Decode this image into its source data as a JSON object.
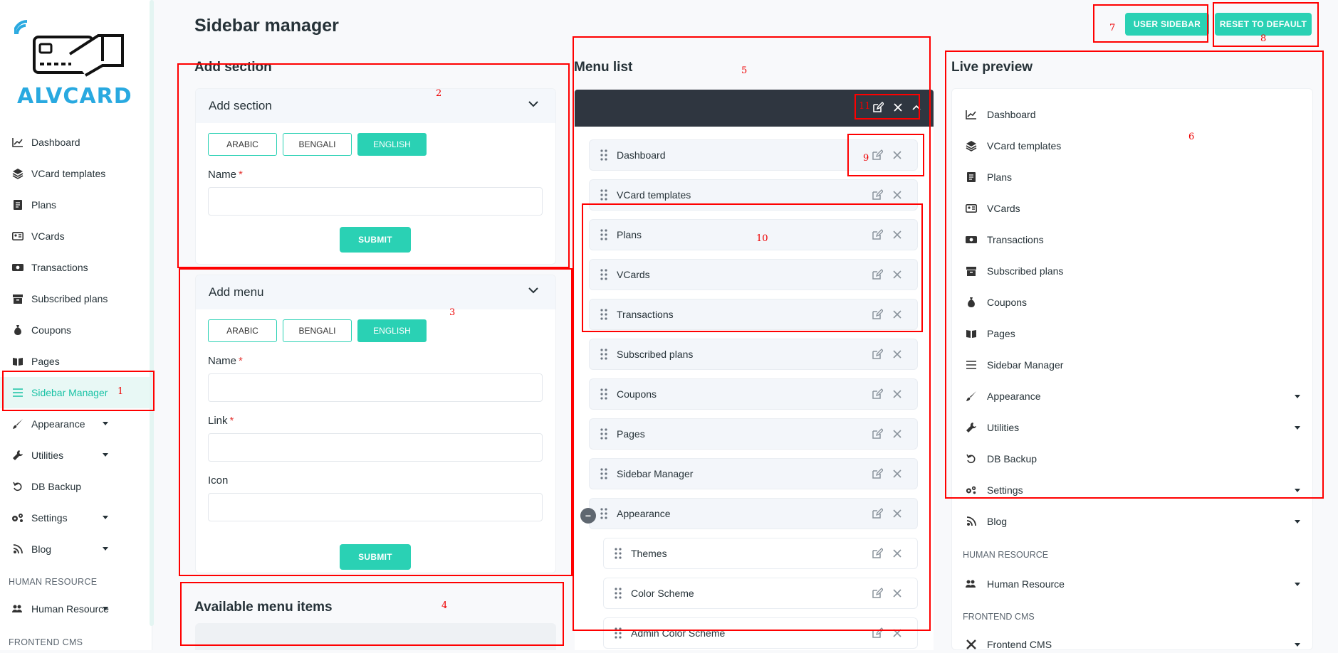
{
  "brand": {
    "logo_text": "ALVCARD"
  },
  "sidebar": {
    "items": [
      {
        "label": "Dashboard",
        "icon": "chart-line-icon",
        "dropdown": false,
        "active": false
      },
      {
        "label": "VCard templates",
        "icon": "layers-icon",
        "dropdown": false,
        "active": false
      },
      {
        "label": "Plans",
        "icon": "document-icon",
        "dropdown": false,
        "active": false
      },
      {
        "label": "VCards",
        "icon": "id-card-icon",
        "dropdown": false,
        "active": false
      },
      {
        "label": "Transactions",
        "icon": "money-bill-icon",
        "dropdown": false,
        "active": false
      },
      {
        "label": "Subscribed plans",
        "icon": "archive-box-icon",
        "dropdown": false,
        "active": false
      },
      {
        "label": "Coupons",
        "icon": "money-bag-icon",
        "dropdown": false,
        "active": false
      },
      {
        "label": "Pages",
        "icon": "open-book-icon",
        "dropdown": false,
        "active": false
      },
      {
        "label": "Sidebar Manager",
        "icon": "bars-icon",
        "dropdown": false,
        "active": true
      },
      {
        "label": "Appearance",
        "icon": "paint-brush-icon",
        "dropdown": true,
        "active": false
      },
      {
        "label": "Utilities",
        "icon": "wrench-icon",
        "dropdown": true,
        "active": false
      },
      {
        "label": "DB Backup",
        "icon": "undo-icon",
        "dropdown": false,
        "active": false
      },
      {
        "label": "Settings",
        "icon": "gears-icon",
        "dropdown": true,
        "active": false
      },
      {
        "label": "Blog",
        "icon": "blog-icon",
        "dropdown": true,
        "active": false
      }
    ],
    "heading_hr": "HUMAN RESOURCE",
    "item_hr": {
      "label": "Human Resource",
      "icon": "users-cog-icon"
    },
    "heading_cms": "FRONTEND CMS"
  },
  "page": {
    "title": "Sidebar manager"
  },
  "toolbar": {
    "user_sidebar": "USER SIDEBAR",
    "reset_default": "RESET TO DEFAULT"
  },
  "add_section": {
    "column_title": "Add section",
    "card_title": "Add section",
    "languages": [
      "ARABIC",
      "BENGALI",
      "ENGLISH"
    ],
    "selected_language": "ENGLISH",
    "name_label": "Name",
    "required_mark": "*",
    "name_value": "",
    "submit": "SUBMIT"
  },
  "add_menu": {
    "card_title": "Add menu",
    "languages": [
      "ARABIC",
      "BENGALI",
      "ENGLISH"
    ],
    "selected_language": "ENGLISH",
    "name_label": "Name",
    "link_label": "Link",
    "icon_label": "Icon",
    "required_mark": "*",
    "name_value": "",
    "link_value": "",
    "icon_value": "",
    "submit": "SUBMIT"
  },
  "available": {
    "title": "Available menu items"
  },
  "menu_list": {
    "title": "Menu list",
    "items": [
      {
        "label": "Dashboard",
        "child": false
      },
      {
        "label": "VCard templates",
        "child": false
      },
      {
        "label": "Plans",
        "child": false
      },
      {
        "label": "VCards",
        "child": false
      },
      {
        "label": "Transactions",
        "child": false
      },
      {
        "label": "Subscribed plans",
        "child": false
      },
      {
        "label": "Coupons",
        "child": false
      },
      {
        "label": "Pages",
        "child": false
      },
      {
        "label": "Sidebar Manager",
        "child": false
      },
      {
        "label": "Appearance",
        "child": false
      },
      {
        "label": "Themes",
        "child": true
      },
      {
        "label": "Color Scheme",
        "child": true
      },
      {
        "label": "Admin Color Scheme",
        "child": true
      }
    ],
    "collapse_symbol": "−"
  },
  "live_preview": {
    "title": "Live preview",
    "items": [
      {
        "label": "Dashboard",
        "icon": "chart-line-icon",
        "dropdown": false
      },
      {
        "label": "VCard templates",
        "icon": "layers-icon",
        "dropdown": false
      },
      {
        "label": "Plans",
        "icon": "document-icon",
        "dropdown": false
      },
      {
        "label": "VCards",
        "icon": "id-card-icon",
        "dropdown": false
      },
      {
        "label": "Transactions",
        "icon": "money-bill-icon",
        "dropdown": false
      },
      {
        "label": "Subscribed plans",
        "icon": "archive-box-icon",
        "dropdown": false
      },
      {
        "label": "Coupons",
        "icon": "money-bag-icon",
        "dropdown": false
      },
      {
        "label": "Pages",
        "icon": "open-book-icon",
        "dropdown": false
      },
      {
        "label": "Sidebar Manager",
        "icon": "bars-icon",
        "dropdown": false
      },
      {
        "label": "Appearance",
        "icon": "paint-brush-icon",
        "dropdown": true
      },
      {
        "label": "Utilities",
        "icon": "wrench-icon",
        "dropdown": true
      },
      {
        "label": "DB Backup",
        "icon": "undo-icon",
        "dropdown": false
      },
      {
        "label": "Settings",
        "icon": "gears-icon",
        "dropdown": true
      },
      {
        "label": "Blog",
        "icon": "blog-icon",
        "dropdown": true
      }
    ],
    "heading_hr": "HUMAN RESOURCE",
    "item_hr": {
      "label": "Human Resource",
      "icon": "users-cog-icon"
    },
    "heading_cms": "FRONTEND CMS",
    "item_cms": {
      "label": "Frontend CMS",
      "icon": "tools-icon"
    }
  },
  "annotations": [
    "1",
    "2",
    "3",
    "4",
    "5",
    "6",
    "7",
    "8",
    "9",
    "10",
    "11"
  ],
  "colors": {
    "accent": "#2ad1b4",
    "annotation": "#ff0000",
    "menu_header": "#2f3640",
    "active_bg": "#e8f8f5"
  }
}
